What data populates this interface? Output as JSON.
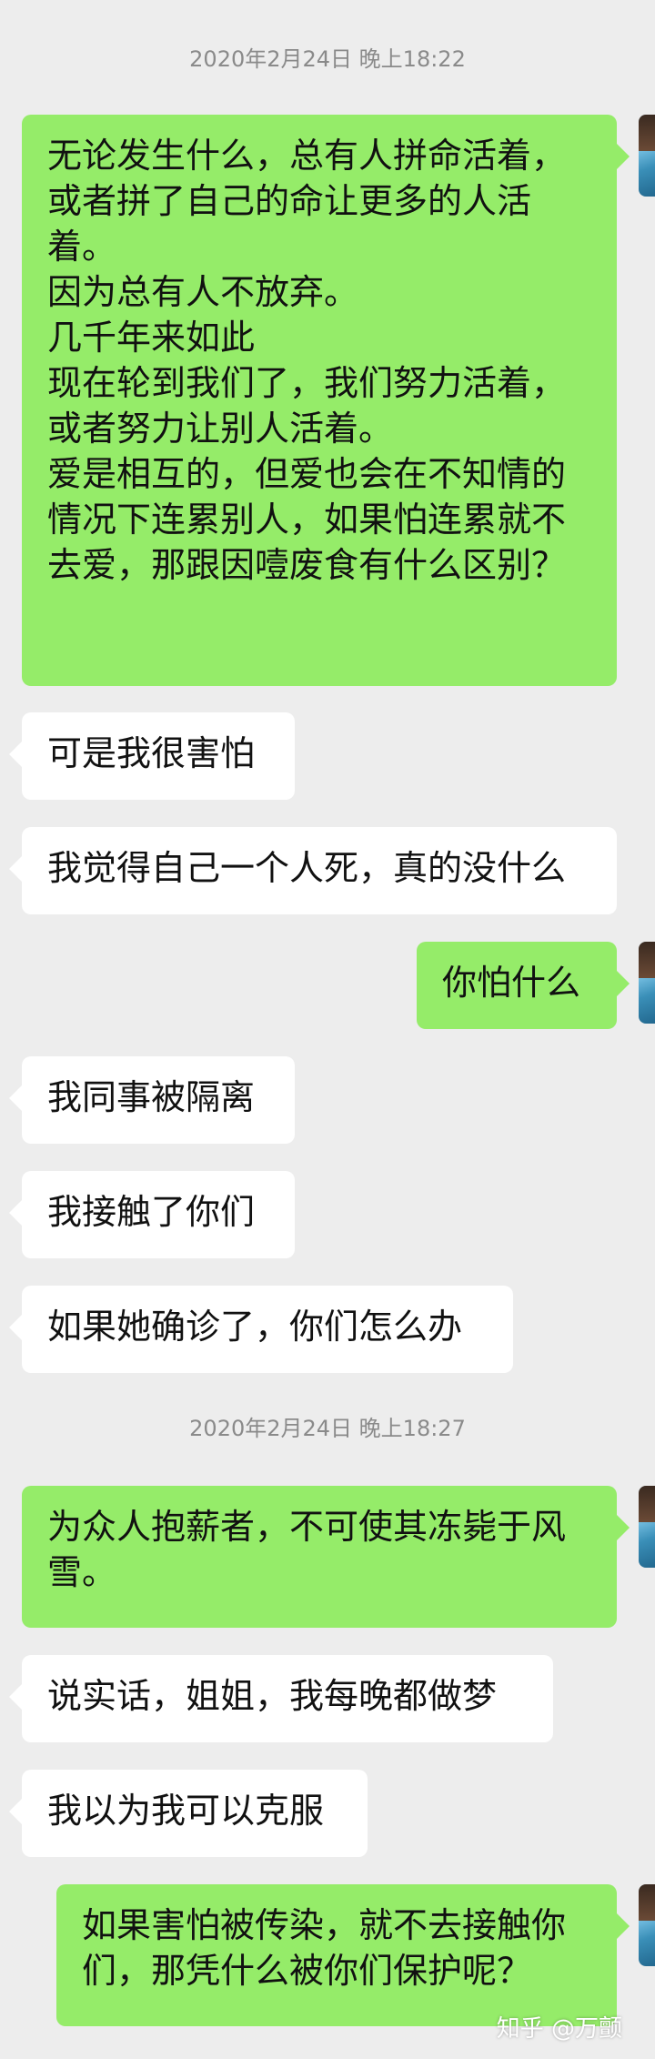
{
  "messages": [
    {
      "type": "time",
      "text": "2020年2月24日 晚上18:22"
    },
    {
      "type": "bubble",
      "side": "right",
      "text": "无论发生什么，总有人拼命活着，\n或者拼了自己的命让更多的人活\n着。\n因为总有人不放弃。\n几千年来如此\n现在轮到我们了，我们努力活着，\n或者努力让别人活着。\n爱是相互的，但爱也会在不知情的\n情况下连累别人，如果怕连累就不\n去爱，那跟因噎废食有什么区别？"
    },
    {
      "type": "bubble",
      "side": "left",
      "text": "可是我很害怕"
    },
    {
      "type": "bubble",
      "side": "left",
      "text": "我觉得自己一个人死，真的没什么"
    },
    {
      "type": "bubble",
      "side": "right",
      "text": "你怕什么"
    },
    {
      "type": "bubble",
      "side": "left",
      "text": "我同事被隔离"
    },
    {
      "type": "bubble",
      "side": "left",
      "text": "我接触了你们"
    },
    {
      "type": "bubble",
      "side": "left",
      "text": "如果她确诊了，你们怎么办"
    },
    {
      "type": "time",
      "text": "2020年2月24日 晚上18:27"
    },
    {
      "type": "bubble",
      "side": "right",
      "text": "为众人抱薪者，不可使其冻毙于风\n雪。"
    },
    {
      "type": "bubble",
      "side": "left",
      "text": "说实话，姐姐，我每晚都做梦"
    },
    {
      "type": "bubble",
      "side": "left",
      "text": "我以为我可以克服"
    },
    {
      "type": "bubble",
      "side": "right",
      "text": "如果害怕被传染，就不去接触你\n们，那凭什么被你们保护呢？"
    }
  ],
  "watermark": "知乎 @万颤"
}
